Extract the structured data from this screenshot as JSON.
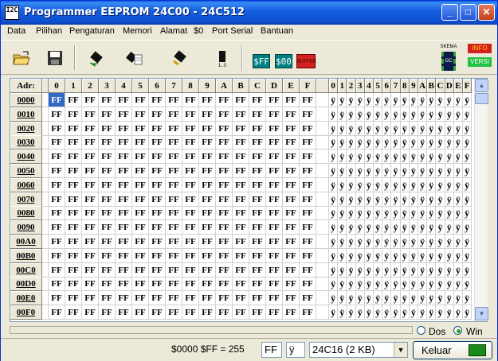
{
  "window": {
    "icon_text": "I2C",
    "title": "Programmer EEPROM 24C00 - 24C512",
    "controls": [
      "_",
      "□",
      "✕"
    ]
  },
  "menu": [
    "Data",
    "Pilihan",
    "Pengaturan",
    "Memori",
    "Alamat",
    "$0",
    "Port Serial",
    "Bantuan"
  ],
  "toolbar": {
    "tools": [
      "open-icon",
      "save-icon",
      "read-chip-icon",
      "verify-chip-icon",
      "write-chip-icon",
      "erase-chip-icon"
    ],
    "fill_ff": "$FF",
    "fill_00": "$00",
    "buffer": "BUFFER",
    "skema": "SKEMA",
    "skema_chip": "I2C",
    "info": "INFO",
    "versi": "VERSI"
  },
  "grid": {
    "adr_label": "Adr:",
    "hex_columns": [
      "0",
      "1",
      "2",
      "3",
      "4",
      "5",
      "6",
      "7",
      "8",
      "9",
      "A",
      "B",
      "C",
      "D",
      "E",
      "F"
    ],
    "ascii_columns": [
      "0",
      "1",
      "2",
      "3",
      "4",
      "5",
      "6",
      "7",
      "8",
      "9",
      "A",
      "B",
      "C",
      "D",
      "E",
      "F"
    ],
    "addresses": [
      "0000",
      "0010",
      "0020",
      "0030",
      "0040",
      "0050",
      "0060",
      "0070",
      "0080",
      "0090",
      "00A0",
      "00B0",
      "00C0",
      "00D0",
      "00E0",
      "00F0"
    ],
    "byte_value": "FF",
    "ascii_char": "ÿ",
    "selected_cell": "0000:0"
  },
  "radio": {
    "dos": "Dos",
    "win": "Win",
    "selected": "Win"
  },
  "status": {
    "address_value": "$0000  $FF = 255",
    "hex_field": "FF",
    "char_field": "ÿ",
    "chip_select": "24C16  (2  KB)",
    "exit_button": "Keluar"
  }
}
